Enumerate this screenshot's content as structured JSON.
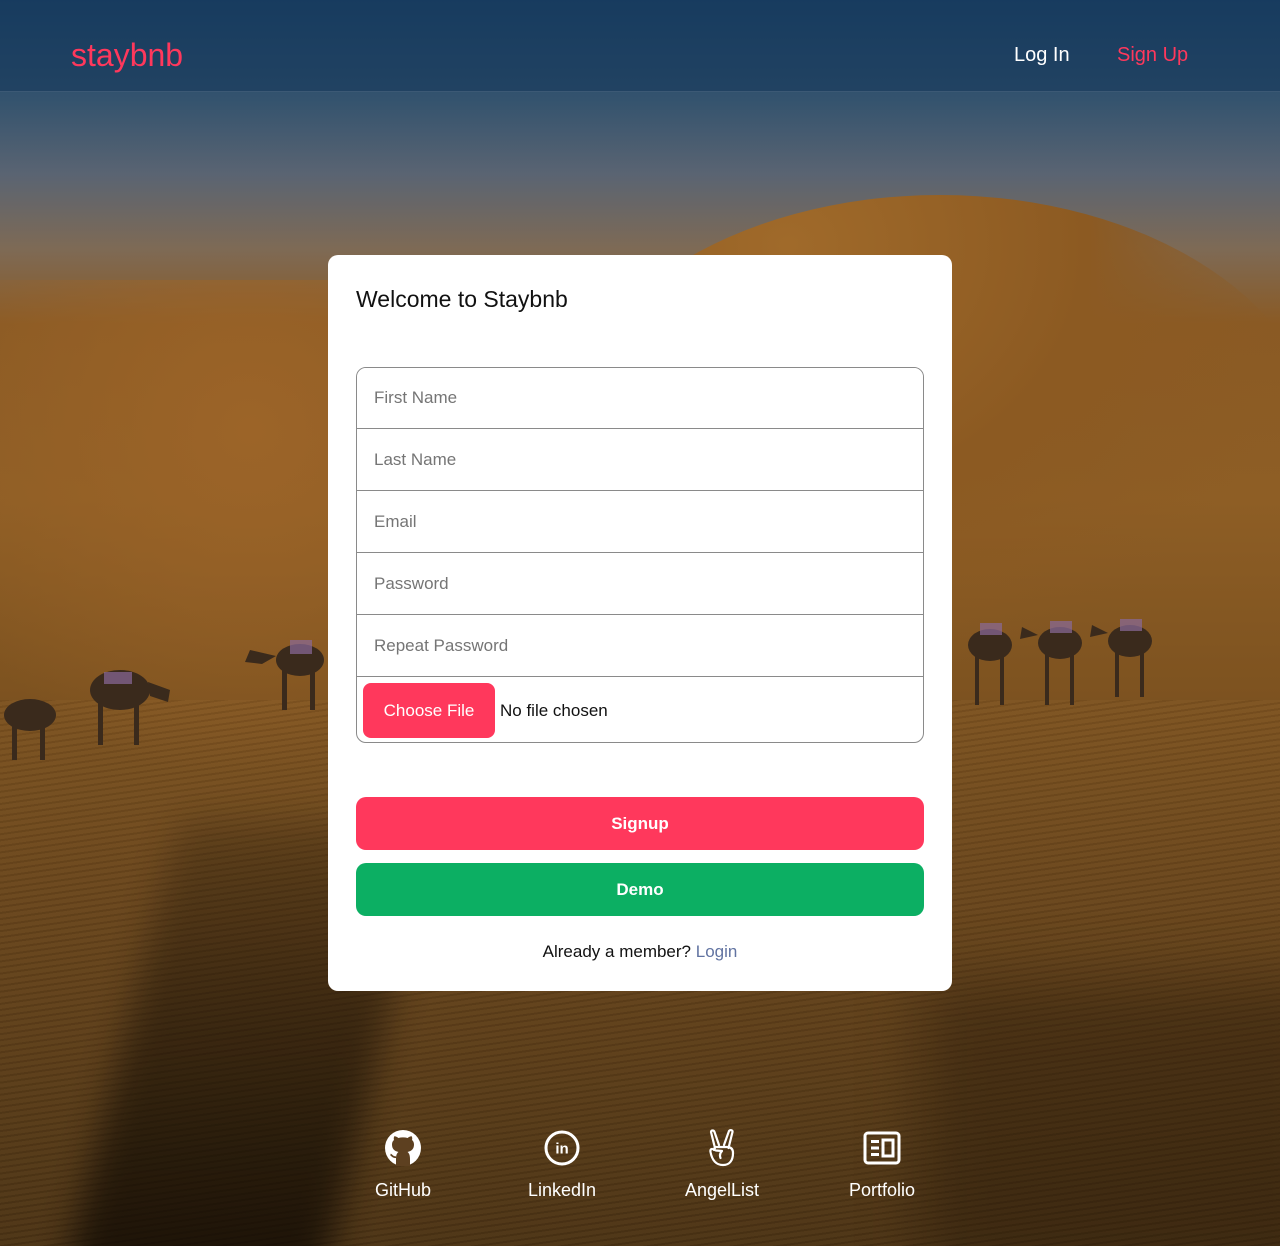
{
  "header": {
    "logo": "staybnb",
    "login_label": "Log In",
    "signup_label": "Sign Up"
  },
  "modal": {
    "title": "Welcome to Staybnb",
    "fields": {
      "first_name_placeholder": "First Name",
      "last_name_placeholder": "Last Name",
      "email_placeholder": "Email",
      "password_placeholder": "Password",
      "repeat_password_placeholder": "Repeat Password"
    },
    "file_input": {
      "button_label": "Choose File",
      "status": "No file chosen"
    },
    "signup_button": "Signup",
    "demo_button": "Demo",
    "member_prompt": "Already a member?",
    "login_link": "Login"
  },
  "footer": {
    "links": [
      {
        "label": "GitHub",
        "icon": "github-icon"
      },
      {
        "label": "LinkedIn",
        "icon": "linkedin-icon"
      },
      {
        "label": "AngelList",
        "icon": "angellist-icon"
      },
      {
        "label": "Portfolio",
        "icon": "portfolio-icon"
      }
    ]
  },
  "colors": {
    "brand": "#ff385c",
    "demo": "#0caf63",
    "link": "#6173a1"
  }
}
